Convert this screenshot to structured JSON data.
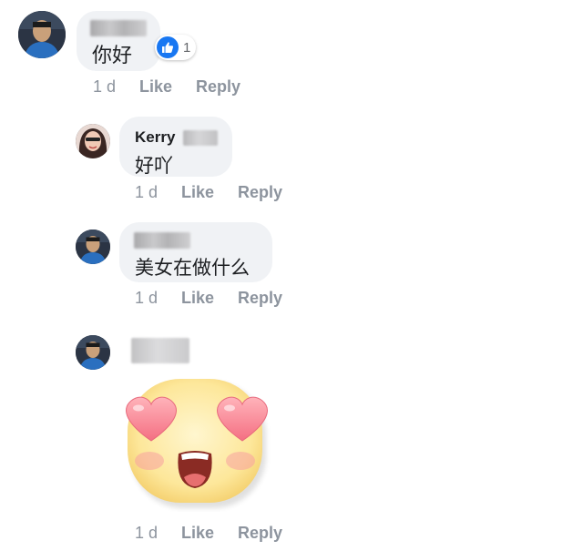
{
  "comments": [
    {
      "author": "",
      "text": "你好",
      "reaction": {
        "icon": "thumbs-up-icon",
        "count": "1",
        "color": "#1877f2"
      },
      "time": "1 d",
      "like": "Like",
      "reply": "Reply"
    },
    {
      "author": "Kerry",
      "text": "好吖",
      "time": "1 d",
      "like": "Like",
      "reply": "Reply"
    },
    {
      "author": "",
      "text": "美女在做什么",
      "time": "1 d",
      "like": "Like",
      "reply": "Reply"
    },
    {
      "author": "",
      "sticker": "heart-eyes-emoji-sticker",
      "time": "1 d",
      "like": "Like",
      "reply": "Reply"
    }
  ]
}
